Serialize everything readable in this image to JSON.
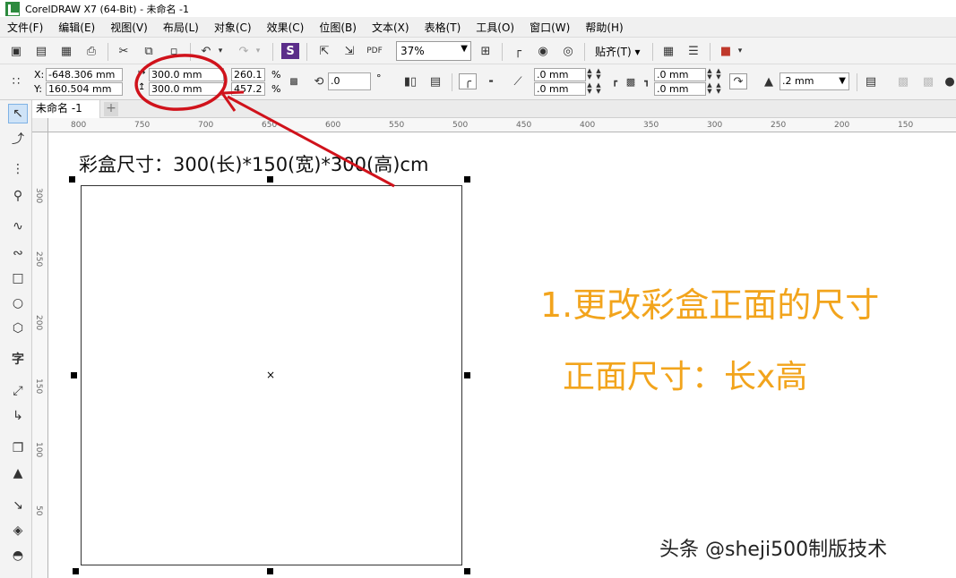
{
  "window": {
    "title": "CorelDRAW X7 (64-Bit) - 未命名 -1"
  },
  "menu": [
    "文件(F)",
    "编辑(E)",
    "视图(V)",
    "布局(L)",
    "对象(C)",
    "效果(C)",
    "位图(B)",
    "文本(X)",
    "表格(T)",
    "工具(O)",
    "窗口(W)",
    "帮助(H)"
  ],
  "toolbar": {
    "zoom": "37%",
    "snap_label": "贴齐(T)"
  },
  "property_bar": {
    "x_label": "X:",
    "x_value": "-648.306 mm",
    "y_label": "Y:",
    "y_value": "160.504 mm",
    "width_value": "300.0 mm",
    "height_value": "300.0 mm",
    "scale_w": "260.1",
    "scale_h": "457.2",
    "percent_1": "%",
    "percent_2": "%",
    "rotation": ".0",
    "degree": "°",
    "corner_1": ".0 mm",
    "corner_2": ".0 mm",
    "corner_3": ".0 mm",
    "corner_4": ".0 mm",
    "outline_width": ".2 mm"
  },
  "tabs": {
    "doc_tab": "未命名 -1",
    "add": "+"
  },
  "rulers": {
    "h_ticks": [
      "800",
      "750",
      "700",
      "650",
      "600",
      "550",
      "500",
      "450",
      "400",
      "350",
      "300",
      "250",
      "200",
      "150"
    ],
    "v_ticks": [
      "300",
      "250",
      "200",
      "150",
      "100",
      "50"
    ]
  },
  "canvas": {
    "caption": "彩盒尺寸：300(长)*150(宽)*300(高)cm",
    "annotation_1": "1.更改彩盒正面的尺寸",
    "annotation_2": "正面尺寸：长x高",
    "watermark": "头条 @sheji500制版技术",
    "center_mark": "×"
  },
  "colors": {
    "annotation": "#f2a41c",
    "circle": "#d0121b",
    "arrow": "#d0121b"
  }
}
